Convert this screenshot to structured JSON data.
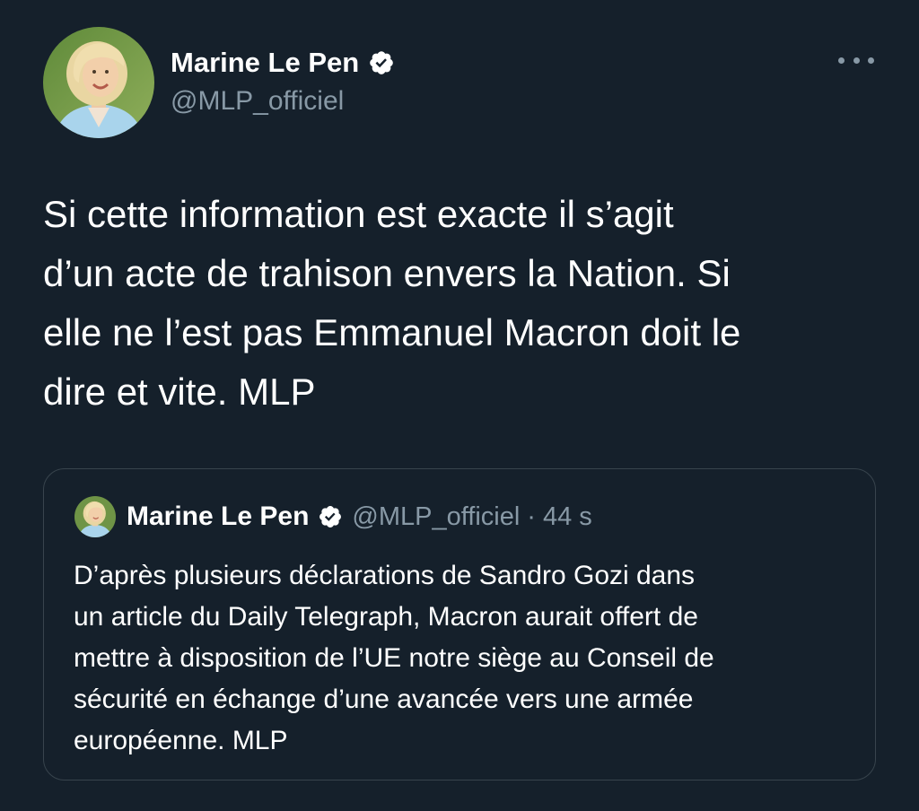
{
  "tweet": {
    "author": {
      "name": "Marine Le Pen",
      "handle": "@MLP_officiel",
      "verified": true,
      "avatar_icon": "profile-photo"
    },
    "more_icon": "more-horizontal-icon",
    "text_lines": [
      "Si cette information est exacte il s’agit",
      "d’un acte de trahison envers la Nation. Si",
      "elle ne l’est pas Emmanuel Macron doit le",
      "dire et vite. MLP"
    ]
  },
  "quote": {
    "author": {
      "name": "Marine Le Pen",
      "handle": "@MLP_officiel",
      "verified": true
    },
    "separator": "·",
    "time": "44 s",
    "text_lines": [
      "D’après plusieurs déclarations de Sandro Gozi dans",
      "un article du Daily Telegraph, Macron aurait offert de",
      "mettre à disposition de l’UE notre siège au Conseil de",
      "sécurité en échange d’une avancée vers une armée",
      "européenne. MLP"
    ]
  },
  "colors": {
    "background": "#15202b",
    "text": "#ffffff",
    "secondary_text": "#8899a6",
    "border": "#38444d",
    "verified_badge": "#ffffff"
  }
}
